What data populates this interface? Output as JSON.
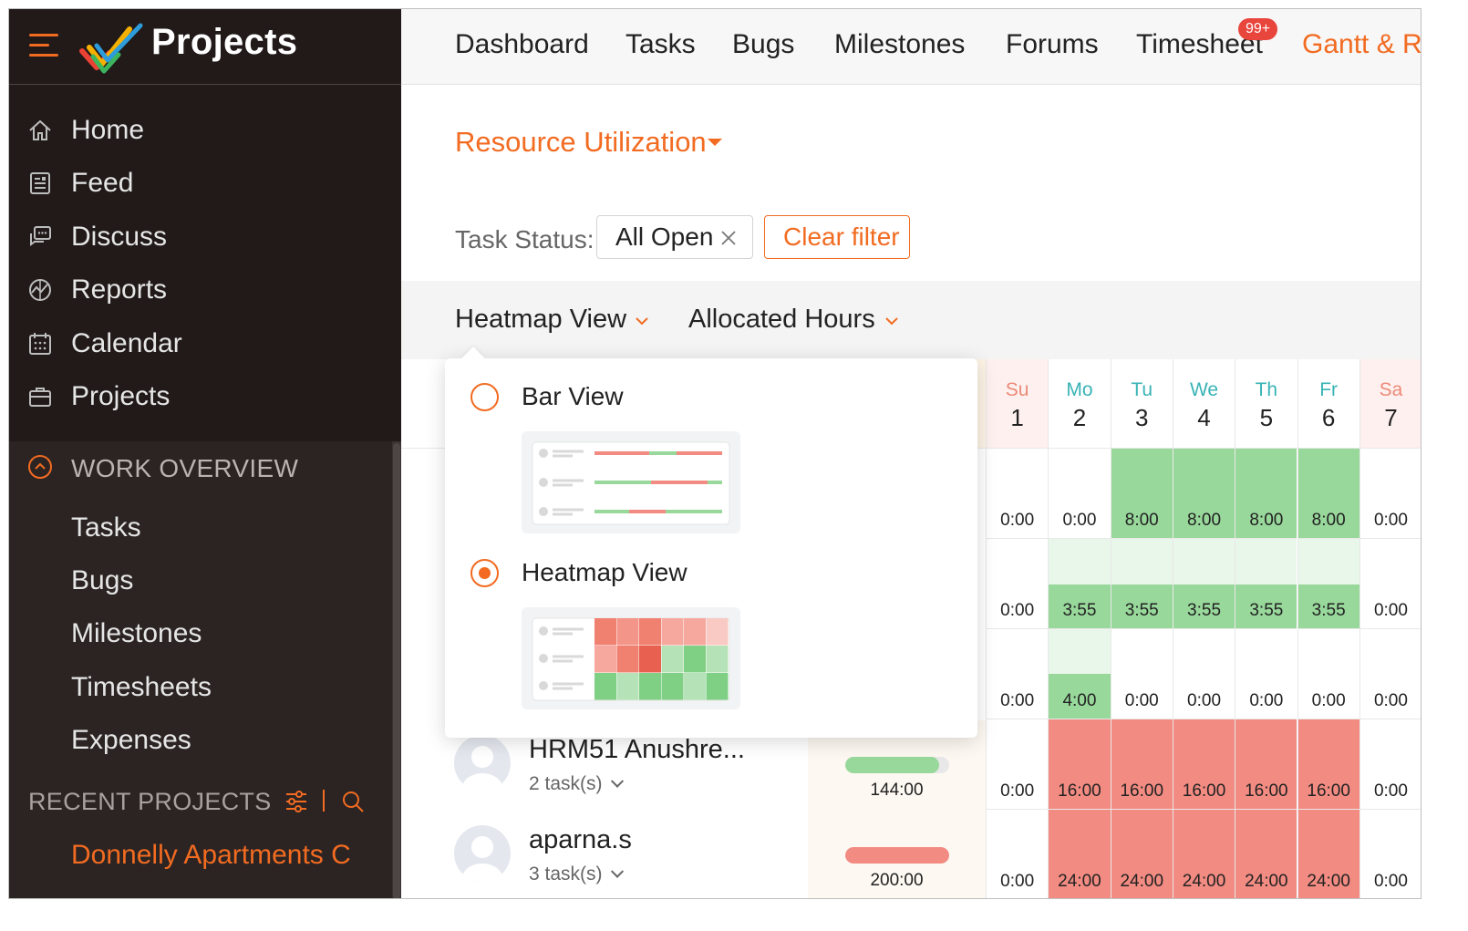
{
  "app": {
    "name": "Projects"
  },
  "sidebar": {
    "items": [
      {
        "label": "Home",
        "icon": "home-icon"
      },
      {
        "label": "Feed",
        "icon": "feed-icon"
      },
      {
        "label": "Discuss",
        "icon": "discuss-icon"
      },
      {
        "label": "Reports",
        "icon": "reports-icon"
      },
      {
        "label": "Calendar",
        "icon": "calendar-icon"
      },
      {
        "label": "Projects",
        "icon": "briefcase-icon"
      }
    ],
    "work_overview": {
      "title": "WORK OVERVIEW",
      "items": [
        "Tasks",
        "Bugs",
        "Milestones",
        "Timesheets",
        "Expenses"
      ]
    },
    "recent": {
      "title": "RECENT PROJECTS",
      "project": "Donnelly Apartments C"
    }
  },
  "topnav": {
    "tabs": [
      "Dashboard",
      "Tasks",
      "Bugs",
      "Milestones",
      "Forums",
      "Timesheet",
      "Gantt & Re"
    ],
    "badge": "99+"
  },
  "report": {
    "title": "Resource Utilization",
    "filter_label": "Task Status:",
    "filter_chip": "All Open",
    "clear_filter": "Clear filter",
    "view_selector": "Heatmap View",
    "metric_selector": "Allocated Hours"
  },
  "view_menu": {
    "options": [
      {
        "label": "Bar View",
        "selected": false
      },
      {
        "label": "Heatmap View",
        "selected": true
      }
    ]
  },
  "days": [
    {
      "name": "Su",
      "num": "1",
      "weekend": true
    },
    {
      "name": "Mo",
      "num": "2",
      "weekend": false
    },
    {
      "name": "Tu",
      "num": "3",
      "weekend": false
    },
    {
      "name": "We",
      "num": "4",
      "weekend": false
    },
    {
      "name": "Th",
      "num": "5",
      "weekend": false
    },
    {
      "name": "Fr",
      "num": "6",
      "weekend": false
    },
    {
      "name": "Sa",
      "num": "7",
      "weekend": true
    }
  ],
  "rows": [
    {
      "values": [
        "0:00",
        "0:00",
        "8:00",
        "8:00",
        "8:00",
        "8:00",
        "0:00"
      ]
    },
    {
      "values": [
        "0:00",
        "3:55",
        "3:55",
        "3:55",
        "3:55",
        "3:55",
        "0:00"
      ]
    },
    {
      "values": [
        "0:00",
        "4:00",
        "0:00",
        "0:00",
        "0:00",
        "0:00",
        "0:00"
      ]
    },
    {
      "user": "HRM51 Anushre...",
      "tasks": "2 task(s)",
      "allocated": "144:00",
      "alloc_fill": 0.9,
      "alloc_status": "ok",
      "values": [
        "0:00",
        "16:00",
        "16:00",
        "16:00",
        "16:00",
        "16:00",
        "0:00"
      ]
    },
    {
      "user": "aparna.s",
      "tasks": "3 task(s)",
      "allocated": "200:00",
      "alloc_fill": 1.0,
      "alloc_status": "over",
      "values": [
        "0:00",
        "24:00",
        "24:00",
        "24:00",
        "24:00",
        "24:00",
        "0:00"
      ]
    }
  ],
  "colors": {
    "accent": "#f26b21",
    "sidebar_bg": "#211a19",
    "heat_green": "#98d89b",
    "heat_light_green": "#e9f6ea",
    "heat_red": "#f28b82",
    "weekday_text": "#39b3b5",
    "weekend_text": "#ec8a78"
  }
}
